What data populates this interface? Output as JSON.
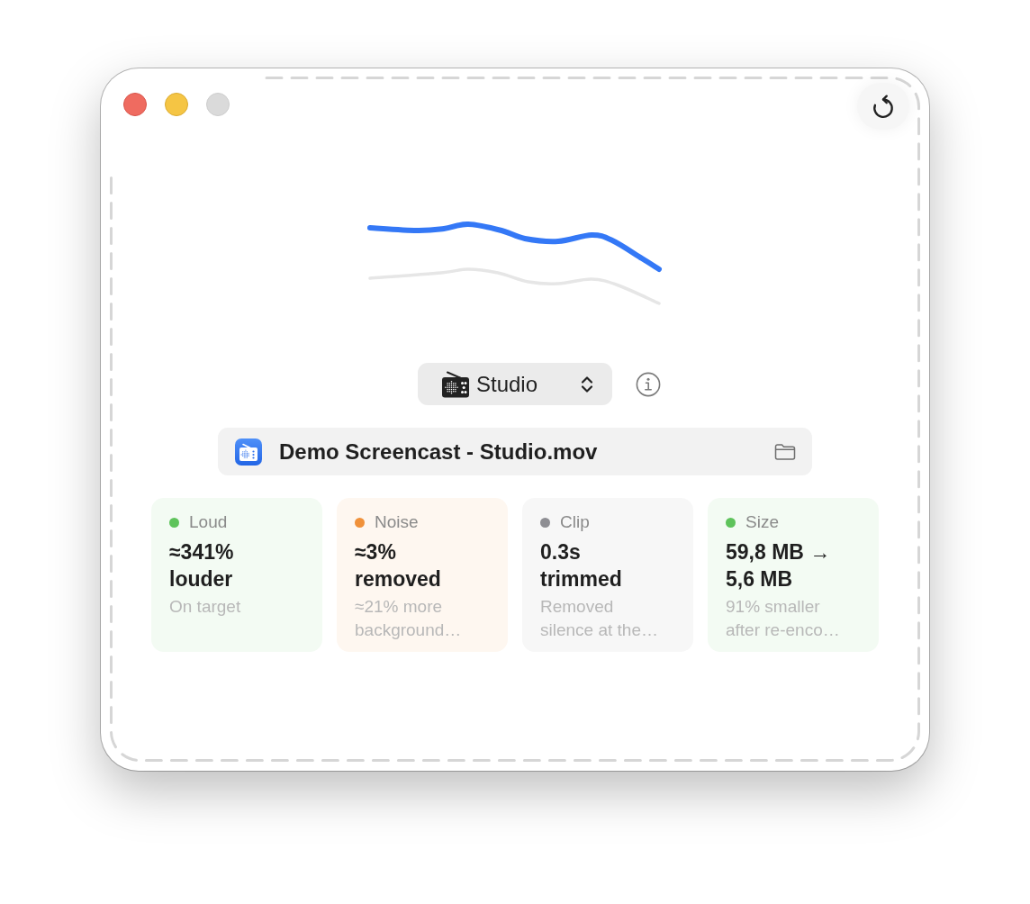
{
  "window": {
    "controls": [
      {
        "kind": "close",
        "disabled": false
      },
      {
        "kind": "minimize",
        "disabled": false
      },
      {
        "kind": "zoom",
        "disabled": true
      }
    ]
  },
  "preset": {
    "label": "Studio"
  },
  "file": {
    "name": "Demo Screencast - Studio.mov"
  },
  "stats": [
    {
      "label": "Loud",
      "color": "#5ec35b",
      "value": "≈341% louder",
      "note": "On target"
    },
    {
      "label": "Noise",
      "color": "#f0913a",
      "value": "≈3% removed",
      "note": "≈21% more background…"
    },
    {
      "label": "Clip",
      "color": "#8e8e93",
      "value": "0.3s trimmed",
      "note": "Removed silence at the…"
    },
    {
      "label": "Size",
      "color": "#5ec35b",
      "value": "59,8 MB → 5,6 MB",
      "note": "91% smaller after re-enco…"
    }
  ]
}
